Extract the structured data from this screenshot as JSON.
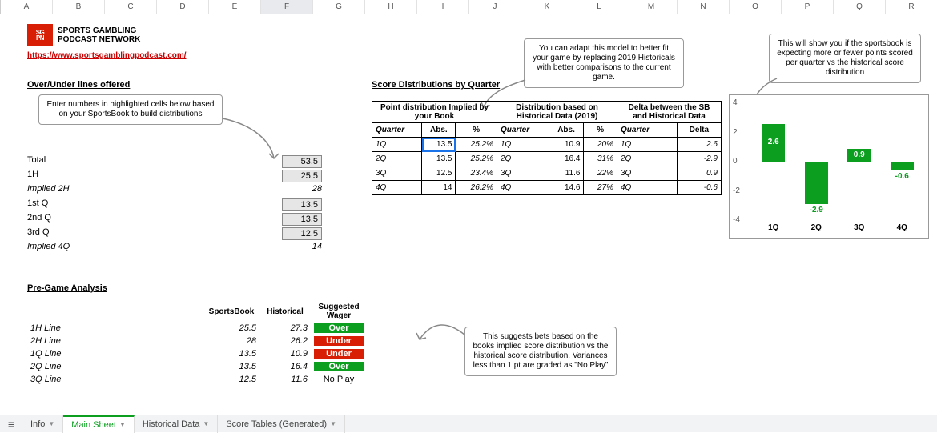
{
  "columns": [
    "A",
    "B",
    "C",
    "D",
    "E",
    "F",
    "G",
    "H",
    "I",
    "J",
    "K",
    "L",
    "M",
    "N",
    "O",
    "P",
    "Q",
    "R"
  ],
  "selected_col": "F",
  "logo": {
    "mark1": "SG",
    "mark2": "PN",
    "line1": "SPORTS GAMBLING",
    "line2": "PODCAST NETWORK"
  },
  "url": "https://www.sportsgamblingpodcast.com/",
  "sections": {
    "over_under": "Over/Under lines offered",
    "score_dist": "Score Distributions by Quarter",
    "pregame": "Pre-Game Analysis"
  },
  "notes": {
    "left": "Enter numbers in highlighted cells below based on your SportsBook to build distributions",
    "top": "You can adapt this model to better fit your game by replacing 2019 Historicals with better comparisons to the current game.",
    "right": "This will show you if the sportsbook is expecting more or fewer points scored per quarter vs the historical score distribution",
    "bottom": "This suggests bets based on the books implied score distribution vs the historical score distribution. Variances less than 1 pt are graded as \"No Play\""
  },
  "inputs": [
    {
      "label": "Total",
      "value": "53.5",
      "highlighted": true
    },
    {
      "label": "1H",
      "value": "25.5",
      "highlighted": true
    },
    {
      "label": "Implied 2H",
      "value": "28",
      "highlighted": false,
      "italic": true
    },
    {
      "label": "1st Q",
      "value": "13.5",
      "highlighted": true
    },
    {
      "label": "2nd Q",
      "value": "13.5",
      "highlighted": true
    },
    {
      "label": "3rd Q",
      "value": "12.5",
      "highlighted": true
    },
    {
      "label": "Implied 4Q",
      "value": "14",
      "highlighted": false,
      "italic": true
    }
  ],
  "dist_tables": {
    "h1": "Point distribution Implied by your Book",
    "h2": "Distribution based on Historical Data (2019)",
    "h3": "Delta between the SB and Historical Data",
    "col_labels": {
      "quarter": "Quarter",
      "abs": "Abs.",
      "pct": "%",
      "delta": "Delta"
    },
    "rows": [
      {
        "q": "1Q",
        "abs1": "13.5",
        "pct1": "25.2%",
        "abs2": "10.9",
        "pct2": "20%",
        "delta": "2.6",
        "selected": true
      },
      {
        "q": "2Q",
        "abs1": "13.5",
        "pct1": "25.2%",
        "abs2": "16.4",
        "pct2": "31%",
        "delta": "-2.9"
      },
      {
        "q": "3Q",
        "abs1": "12.5",
        "pct1": "23.4%",
        "abs2": "11.6",
        "pct2": "22%",
        "delta": "0.9"
      },
      {
        "q": "4Q",
        "abs1": "14",
        "pct1": "26.2%",
        "abs2": "14.6",
        "pct2": "27%",
        "delta": "-0.6"
      }
    ]
  },
  "pregame": {
    "headers": {
      "sb": "SportsBook",
      "hist": "Historical",
      "wager": "Suggested Wager"
    },
    "rows": [
      {
        "line": "1H Line",
        "sb": "25.5",
        "hist": "27.3",
        "wager": "Over",
        "cls": "over"
      },
      {
        "line": "2H Line",
        "sb": "28",
        "hist": "26.2",
        "wager": "Under",
        "cls": "under"
      },
      {
        "line": "1Q Line",
        "sb": "13.5",
        "hist": "10.9",
        "wager": "Under",
        "cls": "under"
      },
      {
        "line": "2Q Line",
        "sb": "13.5",
        "hist": "16.4",
        "wager": "Over",
        "cls": "over"
      },
      {
        "line": "3Q Line",
        "sb": "12.5",
        "hist": "11.6",
        "wager": "No Play",
        "cls": "noplay"
      }
    ]
  },
  "chart_data": {
    "type": "bar",
    "title": "",
    "categories": [
      "1Q",
      "2Q",
      "3Q",
      "4Q"
    ],
    "values": [
      2.6,
      -2.9,
      0.9,
      -0.6
    ],
    "ylabel": "",
    "xlabel": "",
    "yticks": [
      "4",
      "2",
      "0",
      "-2",
      "-4"
    ],
    "ylim": [
      -4,
      4
    ]
  },
  "tabs": [
    {
      "label": "Info",
      "active": false
    },
    {
      "label": "Main Sheet",
      "active": true
    },
    {
      "label": "Historical Data",
      "active": false
    },
    {
      "label": "Score Tables (Generated)",
      "active": false
    }
  ]
}
